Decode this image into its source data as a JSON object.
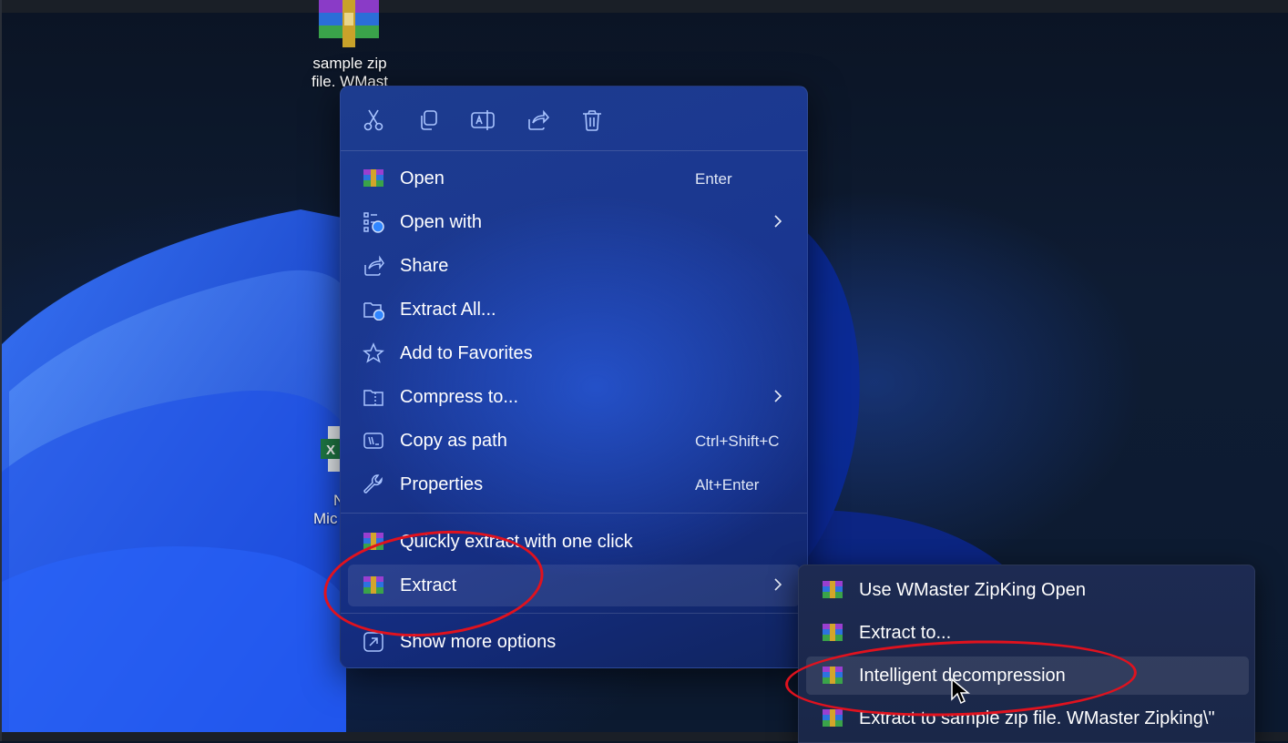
{
  "desktop": {
    "zip_icon_label_line1": "sample zip",
    "zip_icon_label_line2": "file. WMast",
    "excel_icon_label_line1": "N",
    "excel_icon_label_line2": "Mic"
  },
  "toolbar": {
    "icons": [
      "cut-icon",
      "copy-icon",
      "rename-icon",
      "share-icon",
      "delete-icon"
    ]
  },
  "menu": {
    "items": [
      {
        "label": "Open",
        "shortcut": "Enter",
        "icon": "winrar-icon"
      },
      {
        "label": "Open with",
        "shortcut": "",
        "icon": "open-with-icon",
        "submenu": true
      },
      {
        "label": "Share",
        "shortcut": "",
        "icon": "share-icon"
      },
      {
        "label": "Extract All...",
        "shortcut": "",
        "icon": "extract-all-icon"
      },
      {
        "label": "Add to Favorites",
        "shortcut": "",
        "icon": "star-icon"
      },
      {
        "label": "Compress to...",
        "shortcut": "",
        "icon": "compress-icon",
        "submenu": true
      },
      {
        "label": "Copy as path",
        "shortcut": "Ctrl+Shift+C",
        "icon": "copy-path-icon"
      },
      {
        "label": "Properties",
        "shortcut": "Alt+Enter",
        "icon": "wrench-icon"
      },
      {
        "label": "Quickly extract with one click",
        "shortcut": "",
        "icon": "winrar-icon"
      },
      {
        "label": "Extract",
        "shortcut": "",
        "icon": "winrar-icon",
        "submenu": true
      },
      {
        "label": "Show more options",
        "shortcut": "",
        "icon": "more-options-icon"
      }
    ]
  },
  "submenu": {
    "items": [
      {
        "label": "Use WMaster ZipKing Open"
      },
      {
        "label": "Extract to..."
      },
      {
        "label": "Intelligent decompression"
      },
      {
        "label": "Extract to sample zip file. WMaster Zipking\\\""
      }
    ]
  },
  "colors": {
    "annotation": "#e0121e",
    "menu_accent": "#1a3690"
  }
}
